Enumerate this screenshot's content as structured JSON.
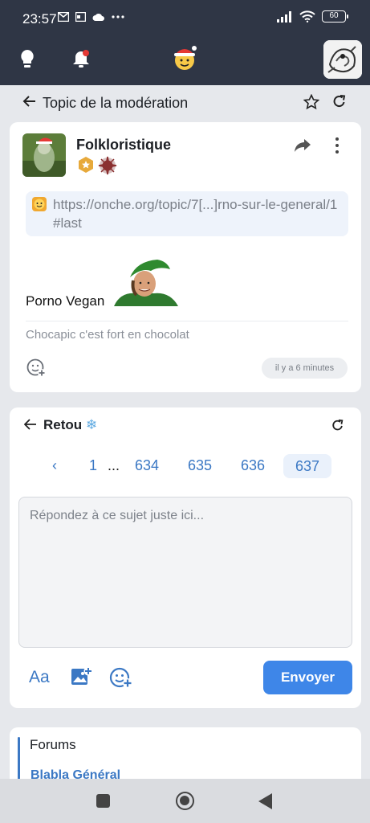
{
  "status_bar": {
    "time": "23:57",
    "battery": "60"
  },
  "topic": {
    "title": "Topic de la modération"
  },
  "post": {
    "username": "Folkloristique",
    "link": "https://onche.org/topic/7[...]rno-sur-le-general/1#last",
    "sticker_caption": "Porno Vegan",
    "signature": "Chocapic c'est fort en chocolat",
    "timestamp": "il y a 6 minutes"
  },
  "reply": {
    "title": "Retou",
    "pages": [
      "1",
      "...",
      "634",
      "635",
      "636",
      "637"
    ],
    "current_page": "637",
    "placeholder": "Répondez à ce sujet juste ici...",
    "format_label": "Aa",
    "send_label": "Envoyer"
  },
  "forums": {
    "title": "Forums",
    "first_item": "Blabla Général"
  },
  "colors": {
    "accent": "#3e86e8",
    "header_bg": "#2f3645",
    "link": "#3b78c4"
  }
}
